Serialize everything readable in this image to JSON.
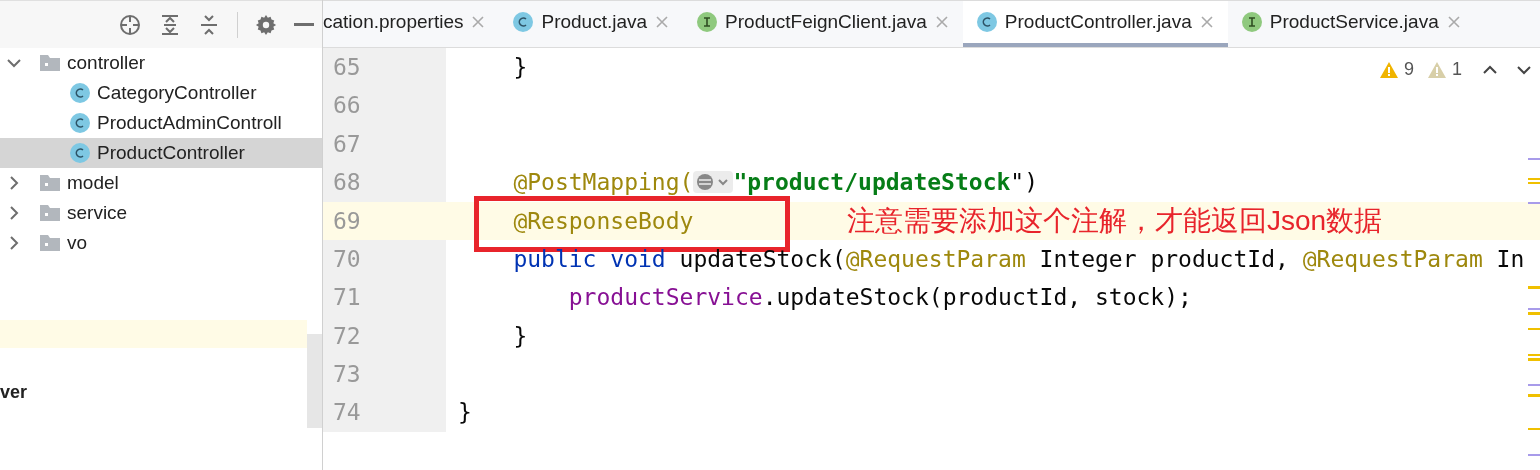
{
  "project_tree": {
    "items": [
      {
        "label": "controller",
        "kind": "folder",
        "expanded": true,
        "selected": false,
        "children": [
          {
            "label": "CategoryController",
            "kind": "class",
            "selected": false
          },
          {
            "label": "ProductAdminControll",
            "kind": "class",
            "selected": false
          },
          {
            "label": "ProductController",
            "kind": "class",
            "selected": true
          }
        ]
      },
      {
        "label": "model",
        "kind": "folder",
        "expanded": false,
        "selected": false
      },
      {
        "label": "service",
        "kind": "folder",
        "expanded": false,
        "selected": false
      },
      {
        "label": "vo",
        "kind": "folder",
        "expanded": false,
        "selected": false
      }
    ],
    "lower_label": "ver"
  },
  "tabs": [
    {
      "label": "cation.properties",
      "kind": "file",
      "selected": false
    },
    {
      "label": "Product.java",
      "kind": "class",
      "selected": false
    },
    {
      "label": "ProductFeignClient.java",
      "kind": "interface",
      "selected": false
    },
    {
      "label": "ProductController.java",
      "kind": "class",
      "selected": true
    },
    {
      "label": "ProductService.java",
      "kind": "interface",
      "selected": false
    }
  ],
  "inspections": {
    "warnings": "9",
    "weak_warnings": "1"
  },
  "editor": {
    "lines": [
      {
        "number": "65",
        "current": false,
        "tokens": [
          {
            "kind": "plain",
            "text": "    }"
          }
        ]
      },
      {
        "number": "66",
        "current": false
      },
      {
        "number": "67",
        "current": false
      },
      {
        "number": "68",
        "current": false,
        "tokens": [
          {
            "kind": "anno",
            "text": "    @PostMapping("
          },
          {
            "kind": "inlay"
          },
          {
            "kind": "str",
            "text": "\"product/updateStock"
          },
          {
            "kind": "plain",
            "text": "\")"
          }
        ]
      },
      {
        "number": "69",
        "current": true,
        "tokens": [
          {
            "kind": "anno",
            "text": "    @ResponseBody"
          }
        ]
      },
      {
        "number": "70",
        "current": false,
        "tokens": [
          {
            "kind": "kw",
            "text": "    public void "
          },
          {
            "kind": "plain",
            "text": "updateStock("
          },
          {
            "kind": "anno",
            "text": "@RequestParam "
          },
          {
            "kind": "plain",
            "text": "Integer productId, "
          },
          {
            "kind": "anno",
            "text": "@RequestParam "
          },
          {
            "kind": "plain",
            "text": "In"
          }
        ]
      },
      {
        "number": "71",
        "current": false,
        "tokens": [
          {
            "kind": "field",
            "text": "        productService"
          },
          {
            "kind": "plain",
            "text": ".updateStock(productId, stock);"
          }
        ]
      },
      {
        "number": "72",
        "current": false,
        "tokens": [
          {
            "kind": "plain",
            "text": "    }"
          }
        ]
      },
      {
        "number": "73",
        "current": false
      },
      {
        "number": "74",
        "current": false,
        "tokens": [
          {
            "kind": "plain",
            "text": "}"
          }
        ]
      }
    ],
    "annotation": "注意需要添加这个注解，才能返回Json数据"
  }
}
